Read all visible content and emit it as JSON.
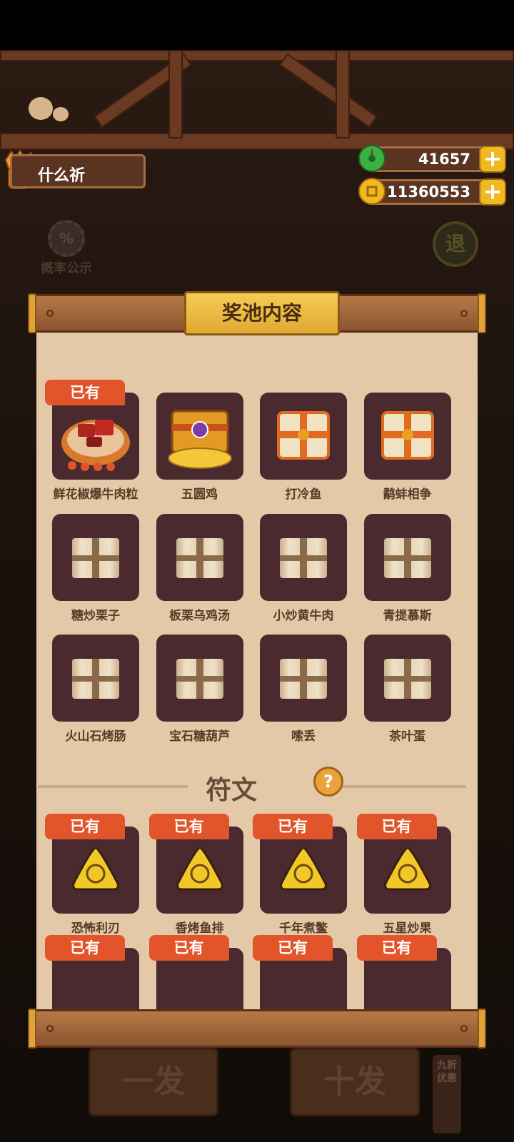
{
  "player": {
    "name": "什么祈"
  },
  "currencies": {
    "jade": {
      "value": "41657",
      "icon": "jade-coin-icon",
      "color": "#3cb043"
    },
    "gold": {
      "value": "11360553",
      "icon": "gold-coin-icon",
      "color": "#f2b822"
    }
  },
  "buttons": {
    "probability": {
      "icon": "%",
      "label": "概率公示"
    },
    "back": {
      "label": "退"
    },
    "draw_one": "一发",
    "draw_ten": "十发",
    "discount": "九折优惠"
  },
  "panel": {
    "title": "奖池内容",
    "owned_label": "已有",
    "dishes": [
      {
        "name": "鲜花椒爆牛肉粒",
        "owned": true,
        "art": "dish"
      },
      {
        "name": "五圆鸡",
        "owned": false,
        "art": "golden-chest"
      },
      {
        "name": "打冷鱼",
        "owned": false,
        "art": "orange-scroll"
      },
      {
        "name": "鹬蚌相争",
        "owned": false,
        "art": "orange-scroll"
      },
      {
        "name": "糖炒栗子",
        "owned": false,
        "art": "scroll"
      },
      {
        "name": "板栗乌鸡汤",
        "owned": false,
        "art": "scroll"
      },
      {
        "name": "小炒黄牛肉",
        "owned": false,
        "art": "scroll"
      },
      {
        "name": "青提慕斯",
        "owned": false,
        "art": "scroll"
      },
      {
        "name": "火山石烤肠",
        "owned": false,
        "art": "scroll"
      },
      {
        "name": "宝石糖葫芦",
        "owned": false,
        "art": "scroll"
      },
      {
        "name": "嗦丢",
        "owned": false,
        "art": "scroll"
      },
      {
        "name": "茶叶蛋",
        "owned": false,
        "art": "scroll"
      }
    ],
    "runes_title": "符文",
    "runes": [
      {
        "name": "恐怖利刃",
        "owned": true
      },
      {
        "name": "香烤鱼排",
        "owned": true
      },
      {
        "name": "千年煮鳖",
        "owned": true
      },
      {
        "name": "五星炒果",
        "owned": true
      }
    ],
    "runes_row2_owned": [
      true,
      true,
      true,
      true
    ]
  }
}
